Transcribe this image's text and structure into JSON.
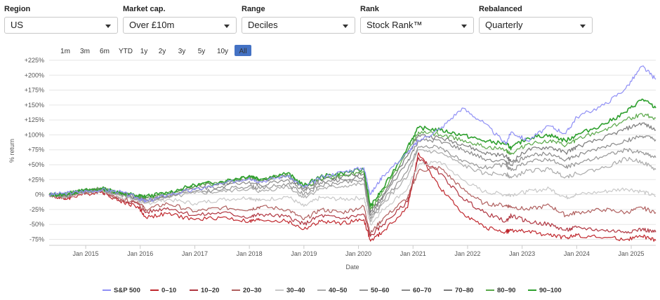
{
  "filters": [
    {
      "label": "Region",
      "value": "US"
    },
    {
      "label": "Market cap.",
      "value": "Over £10m"
    },
    {
      "label": "Range",
      "value": "Deciles"
    },
    {
      "label": "Rank",
      "value": "Stock Rank™"
    },
    {
      "label": "Rebalanced",
      "value": "Quarterly"
    }
  ],
  "range_buttons": [
    "1m",
    "3m",
    "6m",
    "YTD",
    "1y",
    "2y",
    "3y",
    "5y",
    "10y",
    "All"
  ],
  "active_range": "All",
  "colors": {
    "active_button_bg": "#4472c4",
    "grid": "#e6e6e6"
  },
  "chart_data": {
    "type": "line",
    "xlabel": "Date",
    "ylabel": "% return",
    "ylim": [
      -85,
      232
    ],
    "y_ticks": [
      225,
      200,
      175,
      150,
      125,
      100,
      75,
      50,
      25,
      0,
      -25,
      -50,
      -75
    ],
    "y_tick_labels": [
      "+225%",
      "+200%",
      "+175%",
      "+150%",
      "+125%",
      "+100%",
      "+75%",
      "+50%",
      "+25%",
      "0%",
      "-25%",
      "-50%",
      "-75%"
    ],
    "xlim": [
      2014.33,
      2025.45
    ],
    "x_ticks": [
      2015,
      2016,
      2017,
      2018,
      2019,
      2020,
      2021,
      2022,
      2023,
      2024,
      2025
    ],
    "x_tick_labels": [
      "Jan 2015",
      "Jan 2016",
      "Jan 2017",
      "Jan 2018",
      "Jan 2019",
      "Jan 2020",
      "Jan 2021",
      "Jan 2022",
      "Jan 2023",
      "Jan 2024",
      "Jan 2025"
    ],
    "anchor_dates": [
      2014.33,
      2014.6,
      2014.9,
      2015.3,
      2015.6,
      2015.95,
      2016.1,
      2016.5,
      2017.0,
      2017.5,
      2018.0,
      2018.2,
      2018.7,
      2019.0,
      2019.3,
      2019.7,
      2020.1,
      2020.22,
      2020.45,
      2020.9,
      2021.1,
      2021.5,
      2021.9,
      2022.3,
      2022.7,
      2022.8,
      2023.1,
      2023.5,
      2023.8,
      2024.0,
      2024.5,
      2024.9,
      2025.2,
      2025.45
    ],
    "series": [
      {
        "name": "S&P 500",
        "color": "#8f8ff5",
        "values": [
          0,
          2,
          5,
          8,
          5,
          -5,
          -12,
          0,
          8,
          18,
          28,
          22,
          32,
          12,
          28,
          38,
          45,
          0,
          32,
          70,
          90,
          110,
          145,
          120,
          85,
          105,
          90,
          115,
          102,
          130,
          150,
          178,
          215,
          193
        ]
      },
      {
        "name": "0–10",
        "color": "#c0272d",
        "values": [
          0,
          -8,
          0,
          5,
          -10,
          -20,
          -38,
          -32,
          -42,
          -38,
          -45,
          -42,
          -45,
          -58,
          -45,
          -48,
          -42,
          -78,
          -62,
          -22,
          70,
          10,
          -30,
          -55,
          -62,
          -60,
          -62,
          -68,
          -72,
          -68,
          -72,
          -75,
          -70,
          -77
        ]
      },
      {
        "name": "10–20",
        "color": "#b03540",
        "values": [
          0,
          -6,
          2,
          6,
          -8,
          -15,
          -30,
          -22,
          -35,
          -30,
          -38,
          -33,
          -37,
          -50,
          -35,
          -40,
          -33,
          -70,
          -50,
          -12,
          62,
          35,
          -5,
          -30,
          -45,
          -35,
          -45,
          -50,
          -60,
          -55,
          -60,
          -62,
          -58,
          -63
        ]
      },
      {
        "name": "20–30",
        "color": "#b0605f",
        "values": [
          0,
          -5,
          2,
          6,
          -6,
          -12,
          -25,
          -15,
          -28,
          -22,
          -25,
          -20,
          -25,
          -42,
          -25,
          -30,
          -20,
          -65,
          -40,
          -5,
          40,
          45,
          10,
          -15,
          -18,
          -20,
          -25,
          -18,
          -35,
          -30,
          -25,
          -30,
          -22,
          -30
        ]
      },
      {
        "name": "30–40",
        "color": "#c8c8c8",
        "values": [
          0,
          -4,
          3,
          7,
          -3,
          -10,
          -15,
          -8,
          -15,
          -8,
          -5,
          -10,
          -3,
          -20,
          -5,
          -8,
          -5,
          -50,
          -25,
          10,
          50,
          55,
          25,
          5,
          0,
          0,
          5,
          10,
          -5,
          0,
          5,
          10,
          5,
          -3
        ]
      },
      {
        "name": "40–50",
        "color": "#aaaaaa",
        "values": [
          0,
          -3,
          4,
          7,
          0,
          -8,
          -12,
          -5,
          2,
          5,
          10,
          5,
          14,
          -5,
          10,
          14,
          18,
          -45,
          -15,
          30,
          75,
          70,
          50,
          35,
          35,
          28,
          40,
          42,
          30,
          35,
          45,
          60,
          55,
          42
        ]
      },
      {
        "name": "50–60",
        "color": "#969696",
        "values": [
          0,
          -2,
          5,
          8,
          0,
          -6,
          -10,
          -3,
          5,
          8,
          15,
          10,
          18,
          0,
          15,
          20,
          24,
          -40,
          -10,
          40,
          80,
          80,
          55,
          45,
          50,
          40,
          55,
          60,
          45,
          52,
          65,
          75,
          70,
          62
        ]
      },
      {
        "name": "60–70",
        "color": "#8a8a8a",
        "values": [
          0,
          -2,
          5,
          8,
          2,
          -5,
          -8,
          -2,
          10,
          14,
          22,
          16,
          25,
          5,
          20,
          25,
          30,
          -35,
          -5,
          55,
          90,
          90,
          75,
          60,
          55,
          50,
          65,
          70,
          58,
          65,
          80,
          90,
          98,
          92
        ]
      },
      {
        "name": "70–80",
        "color": "#7a7a7a",
        "values": [
          0,
          -1,
          6,
          9,
          3,
          -4,
          -6,
          0,
          14,
          18,
          28,
          22,
          32,
          10,
          25,
          30,
          35,
          -30,
          0,
          65,
          100,
          95,
          85,
          70,
          65,
          55,
          75,
          80,
          70,
          80,
          95,
          110,
          120,
          108
        ]
      },
      {
        "name": "80–90",
        "color": "#5aa84a",
        "values": [
          0,
          0,
          6,
          10,
          4,
          -3,
          -4,
          2,
          15,
          20,
          30,
          24,
          34,
          12,
          27,
          32,
          38,
          -25,
          5,
          72,
          105,
          100,
          92,
          80,
          75,
          68,
          85,
          90,
          82,
          92,
          108,
          125,
          135,
          128
        ]
      },
      {
        "name": "90–100",
        "color": "#2ea02e",
        "values": [
          0,
          0,
          6,
          10,
          4,
          -2,
          -3,
          3,
          16,
          22,
          32,
          26,
          36,
          15,
          30,
          36,
          42,
          -20,
          10,
          80,
          112,
          108,
          100,
          90,
          85,
          78,
          95,
          100,
          90,
          100,
          118,
          138,
          160,
          145
        ]
      }
    ]
  }
}
